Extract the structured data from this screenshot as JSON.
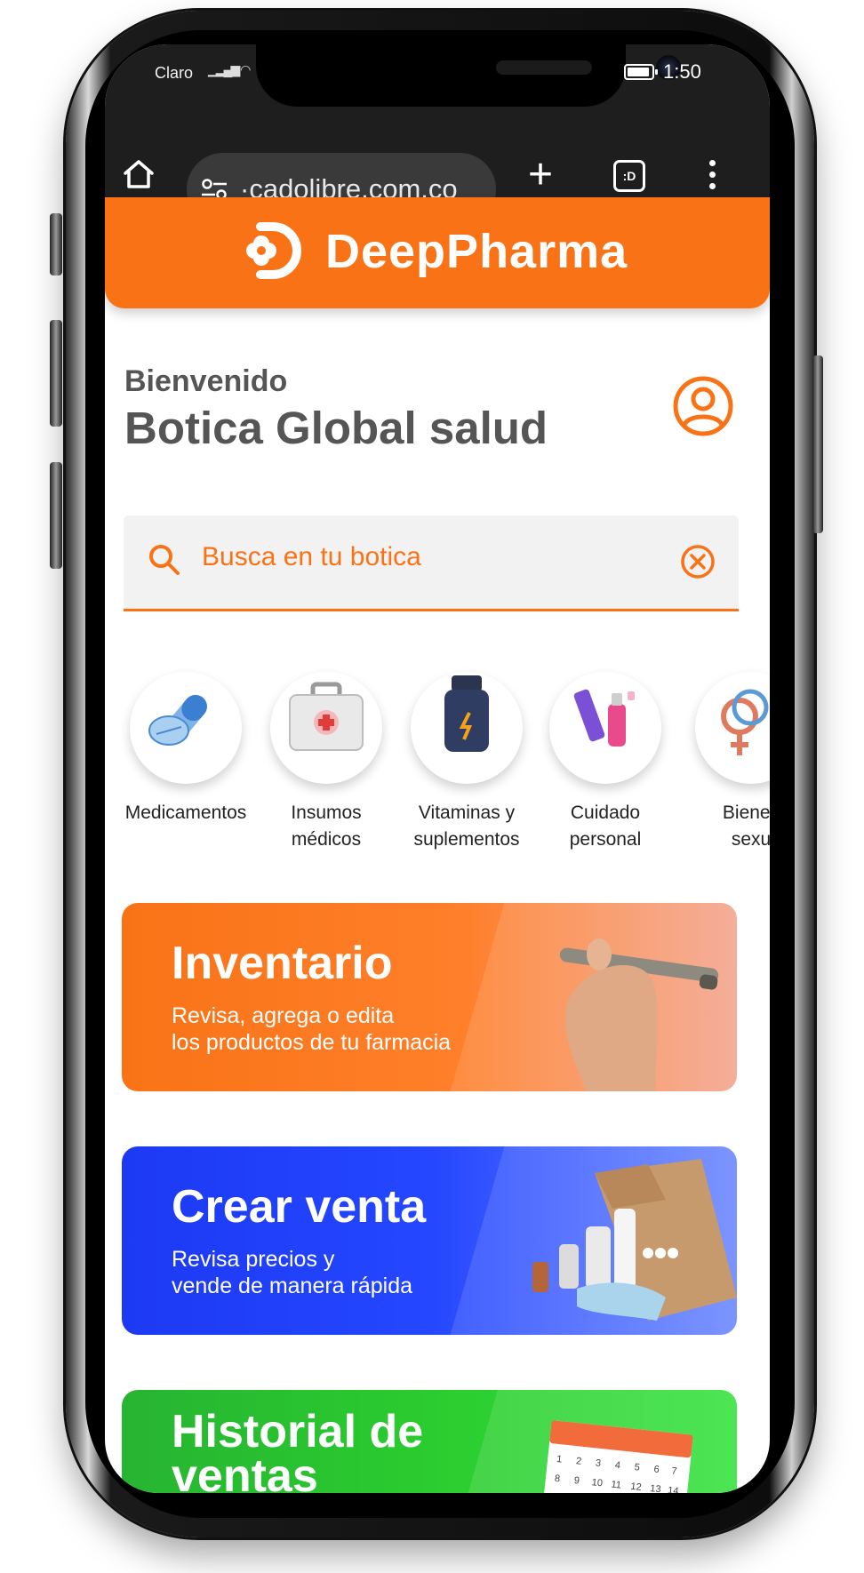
{
  "status_bar": {
    "carrier": "Claro",
    "time": "1:50"
  },
  "browser": {
    "url": "·cadolibre.com.co",
    "tabs_label": ":D"
  },
  "header": {
    "brand": "DeepPharma"
  },
  "greeting": {
    "welcome": "Bienvenido",
    "store_name": "Botica Global salud"
  },
  "search": {
    "placeholder": "Busca en tu botica"
  },
  "categories": [
    {
      "label_line1": "Medicamentos",
      "label_line2": ""
    },
    {
      "label_line1": "Insumos",
      "label_line2": "médicos"
    },
    {
      "label_line1": "Vitaminas y",
      "label_line2": "suplementos"
    },
    {
      "label_line1": "Cuidado",
      "label_line2": "personal"
    },
    {
      "label_line1": "Bienes",
      "label_line2": "sexu"
    }
  ],
  "banners": [
    {
      "title": "Inventario",
      "desc_line1": "Revisa, agrega o edita",
      "desc_line2": "los productos de tu farmacia"
    },
    {
      "title": "Crear venta",
      "desc_line1": "Revisa precios y",
      "desc_line2": "vende de manera rápida"
    },
    {
      "title_line1": "Historial de",
      "title_line2": "ventas"
    }
  ],
  "colors": {
    "brand_orange": "#f97316",
    "sale_blue": "#2447ff",
    "history_green": "#2bcc2f"
  }
}
